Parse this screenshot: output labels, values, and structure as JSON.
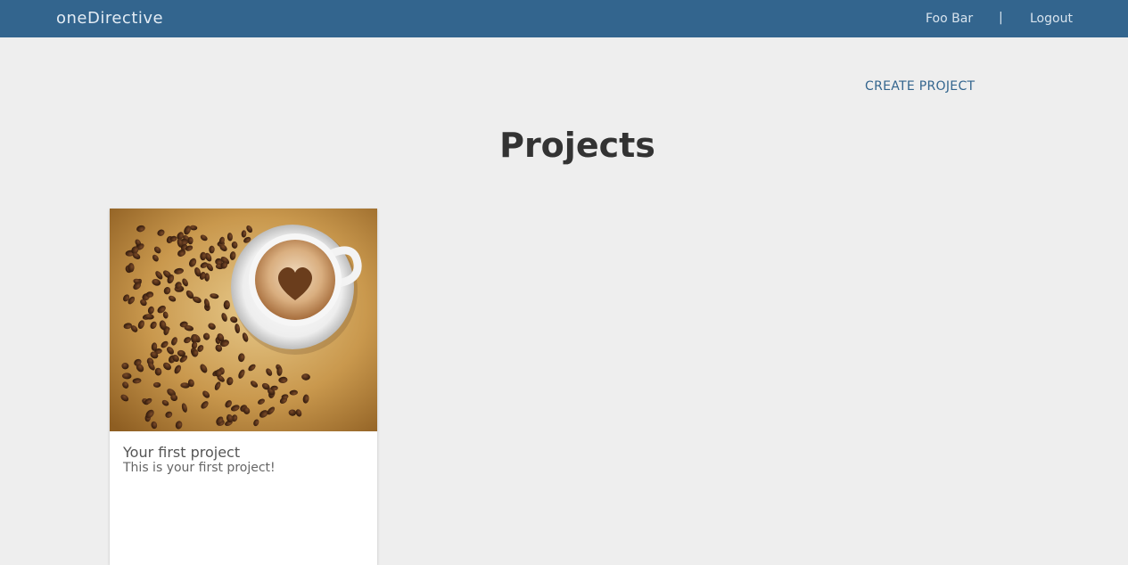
{
  "header": {
    "brand": "oneDirective",
    "user_name": "Foo Bar",
    "separator": "|",
    "logout_label": "Logout",
    "background_color": "#33658e"
  },
  "toolbar": {
    "create_label": "CREATE PROJECT"
  },
  "main": {
    "title": "Projects",
    "projects": [
      {
        "title": "Your first project",
        "description": "This is your first project!",
        "image": "coffee-cup-with-heart-and-beans"
      }
    ]
  }
}
